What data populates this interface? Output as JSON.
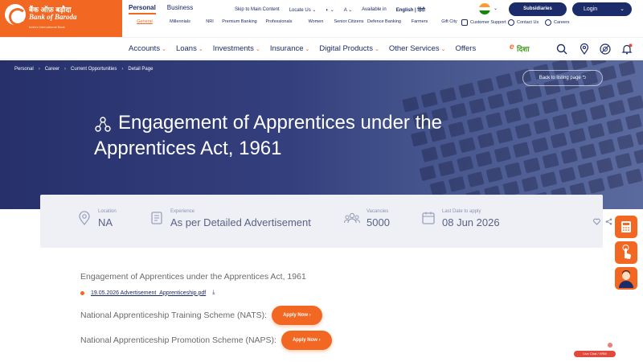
{
  "brand": {
    "name_hindi": "बैंक ऑफ़ बड़ौदा",
    "name_en": "Bank of Baroda",
    "tagline": "India's International Bank",
    "color_primary": "#f26722",
    "color_navy": "#1c2b6a"
  },
  "segments": [
    "Personal",
    "Business"
  ],
  "utility": {
    "skip": "Skip to Main Content",
    "locate": "Locate Us",
    "theme_icon": "contrast-icon",
    "font_size": "A",
    "available_in": "Available in",
    "language": "English",
    "subsidiaries": "Subsidiaries",
    "login": "Login"
  },
  "quick_links": [
    "General",
    "Millennials",
    "NRI",
    "Premium Banking",
    "Professionals",
    "Women",
    "Senior Citizens",
    "Defence Banking",
    "Farmers",
    "Gift City"
  ],
  "quick_icon_links": [
    "Customer Support",
    "Contact Us",
    "Careers"
  ],
  "nav": [
    "Accounts",
    "Loans",
    "Investments",
    "Insurance",
    "Digital Products",
    "Other Services",
    "Offers"
  ],
  "nav_offers": "Offers",
  "edisha": {
    "e": "e",
    "text": "दिशा"
  },
  "breadcrumb": [
    "Personal",
    "Career",
    "Current Opportunities",
    "Detail Page"
  ],
  "back_button": "Back to listing page",
  "hero": {
    "title_line1": "Engagement of Apprentices under the",
    "title_line2": "Apprentices Act, 1961"
  },
  "info": {
    "location_label": "Location",
    "location_value": "NA",
    "experience_label": "Experience",
    "experience_value": "As per Detailed Advertisement",
    "vacancies_label": "Vacancies",
    "vacancies_value": "5000",
    "last_date_label": "Last Date to apply",
    "last_date_value": "08 Jun 2026"
  },
  "content": {
    "title": "Engagement of Apprentices under the Apprentices Act, 1961",
    "pdf_link": "19.05.2026 Advertisement_Apprenticeship.pdf",
    "schemes": [
      {
        "name": "National Apprenticeship Training Scheme (NATS):",
        "button": "Apply Now"
      },
      {
        "name": "National Apprenticeship Promotion Scheme (NAPS):",
        "button": "Apply Now"
      }
    ]
  },
  "float_badge": "Live Chat / VRM"
}
